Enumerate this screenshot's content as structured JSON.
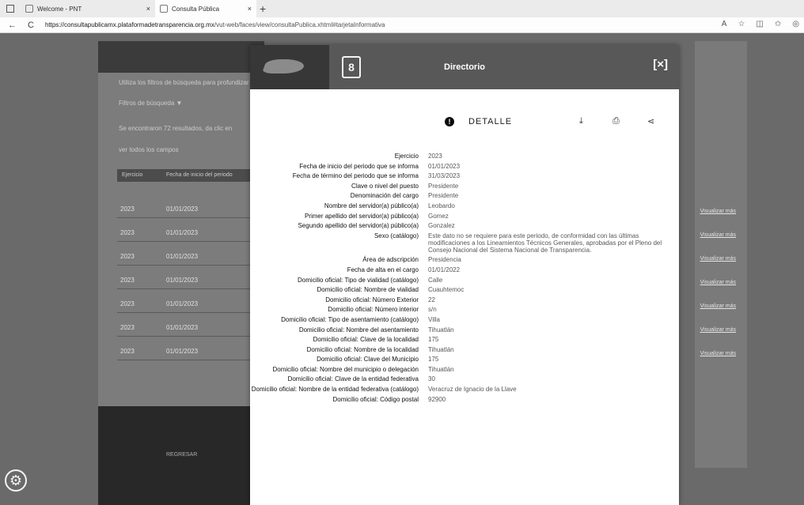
{
  "browser": {
    "tabs": [
      {
        "title": "Welcome - PNT",
        "close": "×"
      },
      {
        "title": "Consulta Pública",
        "close": "×"
      }
    ],
    "new_tab": "+",
    "back": "←",
    "reload": "C",
    "url_host": "https://consultapublicamx.plataformadetransparencia.org.mx",
    "url_path": "/vut-web/faces/view/consultaPublica.xhtml#tarjetaInformativa"
  },
  "background": {
    "filter_text": "Utiliza los filtros de búsqueda para profundizar",
    "filters_label": "Filtros de búsqueda ▼",
    "results_text": "Se encontraron 72 resultados, da clic en",
    "columns_text": "ver todos los campos",
    "table_header": [
      "Ejercicio",
      "Fecha de inicio del periodo"
    ],
    "rows": [
      {
        "year": "2023",
        "date": "01/01/2023"
      },
      {
        "year": "2023",
        "date": "01/01/2023"
      },
      {
        "year": "2023",
        "date": "01/01/2023"
      },
      {
        "year": "2023",
        "date": "01/01/2023"
      },
      {
        "year": "2023",
        "date": "01/01/2023"
      },
      {
        "year": "2023",
        "date": "01/01/2023"
      },
      {
        "year": "2023",
        "date": "01/01/2023"
      }
    ],
    "right_links": [
      "Visualizar más",
      "Visualizar más",
      "Visualizar más",
      "Visualizar más",
      "Visualizar más",
      "Visualizar más",
      "Visualizar más"
    ],
    "footer_text": "REGRESAR"
  },
  "modal": {
    "title": "Directorio",
    "close_label": "[×]",
    "detail_label": "DETALLE",
    "fields": [
      {
        "k": "Ejercicio",
        "v": "2023"
      },
      {
        "k": "Fecha de inicio del periodo que se informa",
        "v": "01/01/2023"
      },
      {
        "k": "Fecha de término del periodo que se informa",
        "v": "31/03/2023"
      },
      {
        "k": "Clave o nivel del puesto",
        "v": "Presidente"
      },
      {
        "k": "Denominación del cargo",
        "v": "Presidente"
      },
      {
        "k": "Nombre del servidor(a) público(a)",
        "v": "Leobardo"
      },
      {
        "k": "Primer apellido del servidor(a) público(a)",
        "v": "Gomez"
      },
      {
        "k": "Segundo apellido del servidor(a) público(a)",
        "v": "Gonzalez"
      },
      {
        "k": "Sexo (catálogo)",
        "v": "Este dato no se requiere para este periodo, de conformidad con las últimas modificaciones a los Lineamientos Técnicos Generales, aprobadas por el Pleno del Consejo Nacional del Sistema Nacional de Transparencia."
      },
      {
        "k": "Área de adscripción",
        "v": "Presidencia"
      },
      {
        "k": "Fecha de alta en el cargo",
        "v": "01/01/2022"
      },
      {
        "k": "Domicilio oficial: Tipo de vialidad (catálogo)",
        "v": "Calle"
      },
      {
        "k": "Domicilio oficial: Nombre de vialidad",
        "v": "Cuauhtemoc"
      },
      {
        "k": "Domicilio oficial: Número Exterior",
        "v": "22"
      },
      {
        "k": "Domicilio oficial: Número interior",
        "v": "s/n"
      },
      {
        "k": "Domicilio oficial: Tipo de asentamiento (catálogo)",
        "v": "Villa"
      },
      {
        "k": "Domicilio oficial: Nombre del asentamiento",
        "v": "Tihuatlán"
      },
      {
        "k": "Domicilio oficial: Clave de la localidad",
        "v": "175"
      },
      {
        "k": "Domicilio oficial: Nombre de la localidad",
        "v": "Tihuatlán"
      },
      {
        "k": "Domicilio oficial: Clave del Municipio",
        "v": "175"
      },
      {
        "k": "Domicilio oficial: Nombre del municipio o delegación",
        "v": "Tihuatlán"
      },
      {
        "k": "Domicilio oficial: Clave de la entidad federativa",
        "v": "30"
      },
      {
        "k": "Domicilio oficial: Nombre de la entidad federativa (catálogo)",
        "v": "Veracruz de Ignacio de la Llave"
      },
      {
        "k": "Domicilio oficial: Código postal",
        "v": "92900"
      }
    ]
  }
}
